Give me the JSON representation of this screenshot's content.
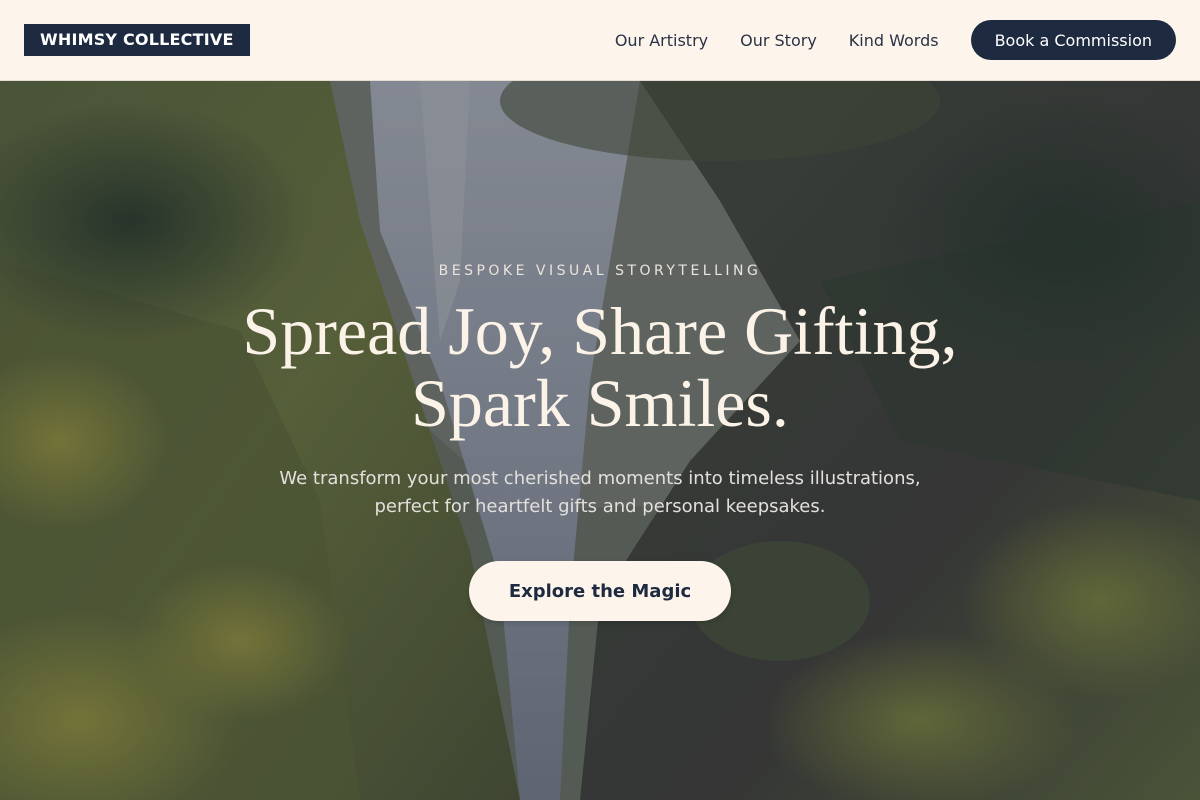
{
  "header": {
    "logo": "WHIMSY COLLECTIVE",
    "nav": [
      {
        "label": "Our Artistry"
      },
      {
        "label": "Our Story"
      },
      {
        "label": "Kind Words"
      }
    ],
    "cta_label": "Book a Commission"
  },
  "hero": {
    "eyebrow": "BESPOKE VISUAL STORYTELLING",
    "headline_line1": "Spread Joy, Share Gifting,",
    "headline_line2": "Spark Smiles.",
    "subtext_line1": "We transform your most cherished moments into timeless illustrations,",
    "subtext_line2": "perfect for heartfelt gifts and personal keepsakes.",
    "button_label": "Explore the Magic"
  },
  "colors": {
    "navy": "#1e2a40",
    "cream": "#fdf4ec",
    "headline": "#fbf3e8"
  }
}
